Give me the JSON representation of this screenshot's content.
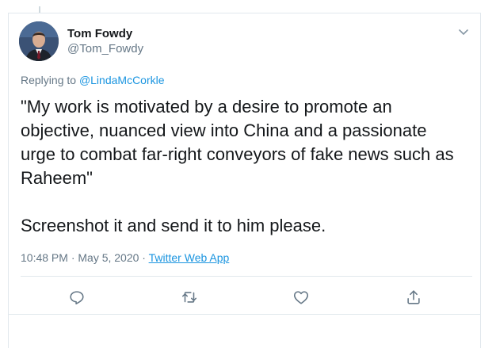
{
  "tweet": {
    "author_name": "Tom Fowdy",
    "author_handle": "@Tom_Fowdy",
    "replying_prefix": "Replying to ",
    "replying_to": "@LindaMcCorkle",
    "text": "\"My work is motivated by a desire to promote an objective, nuanced view into China and a passionate urge to combat far-right conveyors of fake news such as Raheem\"\n\nScreenshot it and send it to him please.",
    "timestamp": "10:48 PM · May 5, 2020 · ",
    "source": "Twitter Web App"
  },
  "icons": {
    "menu": "chevron-down-icon",
    "reply": "reply-icon",
    "retweet": "retweet-icon",
    "like": "like-icon",
    "share": "share-icon"
  },
  "colors": {
    "link": "#1b95e0",
    "secondary_text": "#657786",
    "primary_text": "#14171a",
    "border": "#e1e8ed"
  }
}
